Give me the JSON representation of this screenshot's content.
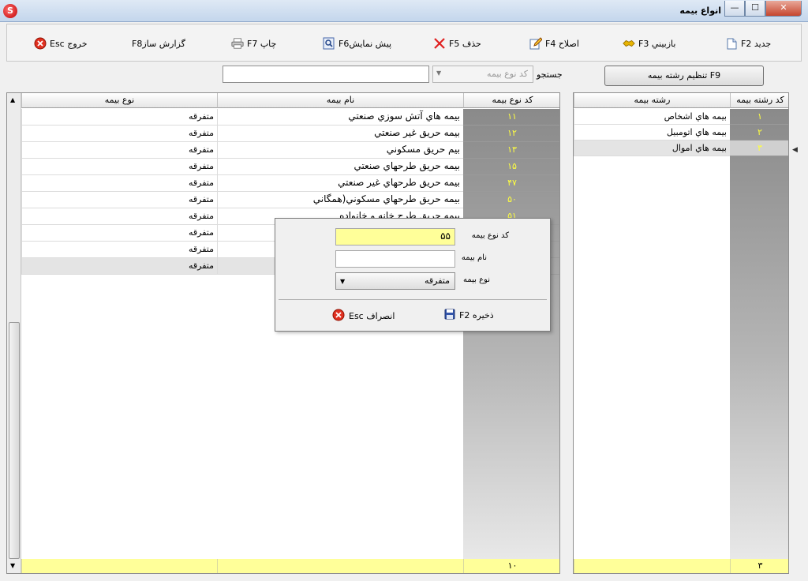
{
  "window": {
    "title": "انواع بيمه",
    "app_icon": "S",
    "min_glyph": "—",
    "max_glyph": "☐",
    "close_glyph": "✕"
  },
  "toolbar": {
    "new_label": "جديد F2",
    "revisit_label": "بازبيني F3",
    "edit_label": "اصلاح F4",
    "delete_label": "حذف F5",
    "preview_label": "پيش نمايشF6",
    "print_label": "چاپ F7",
    "report_label": "گزارش سازF8",
    "exit_label": "خروج Esc"
  },
  "filter": {
    "set_branch_label": "تنظيم رشته بيمه F9",
    "search_label": "جستجو",
    "search_field_value": "كد نوع بيمه",
    "search_value": ""
  },
  "branches": {
    "headers": {
      "code": "كد رشته بيمه",
      "name": "رشته بيمه"
    },
    "rows": [
      {
        "code": "۱",
        "name": "بيمه هاي اشخاص"
      },
      {
        "code": "۲",
        "name": "بيمه هاي اتومبيل"
      },
      {
        "code": "۳",
        "name": "بيمه هاي اموال"
      }
    ],
    "selected_index": 2,
    "footer_count": "۳"
  },
  "types": {
    "headers": {
      "code": "كد نوع بيمه",
      "name": "نام بيمه",
      "kind": "نوع بيمه"
    },
    "rows": [
      {
        "code": "۱۱",
        "name": "بيمه هاي آتش سوزي صنعتي",
        "kind": "متفرقه"
      },
      {
        "code": "۱۲",
        "name": "بيمه حريق غير صنعتي",
        "kind": "متفرقه"
      },
      {
        "code": "۱۳",
        "name": "بيم حريق مسكوني",
        "kind": "متفرقه"
      },
      {
        "code": "۱۵",
        "name": "بيمه حريق طرحهاي صنعتي",
        "kind": "متفرقه"
      },
      {
        "code": "۴۷",
        "name": "بيمه حريق طرحهاي غير صنعتي",
        "kind": "متفرقه"
      },
      {
        "code": "۵۰",
        "name": "بيمه حريق طرحهاي مسكوني(همگاني",
        "kind": "متفرقه"
      },
      {
        "code": "۵۱",
        "name": "بيمه حريق طرح خانه و خانواده",
        "kind": "متفرقه"
      },
      {
        "code": "",
        "name": "",
        "kind": "متفرقه"
      },
      {
        "code": "",
        "name": "",
        "kind": "متفرقه"
      },
      {
        "code": "",
        "name": "",
        "kind": "متفرقه"
      }
    ],
    "selected_index": 9,
    "footer_count": "۱۰"
  },
  "dialog": {
    "code_label": "كد نوع بيمه",
    "code_value": "۵۵",
    "name_label": "نام بيمه",
    "name_value": "",
    "kind_label": "نوع بيمه",
    "kind_value": "متفرقه",
    "save_label": "ذخيره F2",
    "cancel_label": "انصراف Esc"
  },
  "colors": {
    "code_text": "#ffff40",
    "footer_bg": "#ffff99",
    "code_field_bg": "#ffff99"
  }
}
